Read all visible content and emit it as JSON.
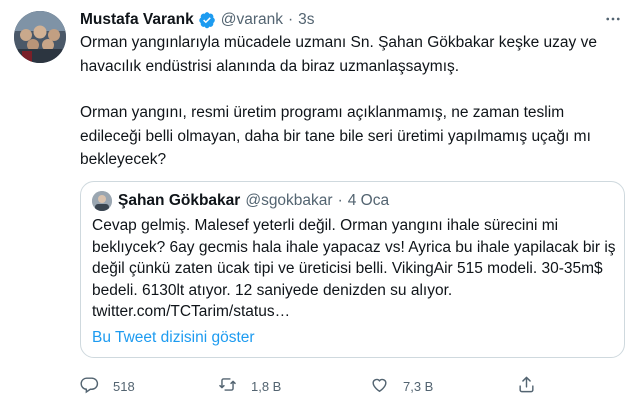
{
  "tweet": {
    "author_name": "Mustafa Varank",
    "handle": "@varank",
    "separator": "·",
    "time": "3s",
    "paragraphs": [
      "Orman yangınlarıyla mücadele uzmanı Sn. Şahan Gökbakar keşke uzay ve havacılık endüstrisi alanında da biraz uzmanlaşsaymış.",
      "Orman yangını, resmi üretim programı açıklanmamış, ne zaman teslim edileceği belli olmayan, daha bir tane bile seri üretimi yapılmamış uçağı mı bekleyecek?"
    ]
  },
  "quote": {
    "author_name": "Şahan Gökbakar",
    "handle": "@sgokbakar",
    "separator": "·",
    "time": "4 Oca",
    "text": "Cevap gelmiş. Malesef yeterli değil. Orman yangını ihale sürecini mi beklıycek? 6ay gecmis hala ihale yapacaz vs! Ayrica bu ihale yapilacak bir iş değil çünkü zaten ücak tipi ve üreticisi belli. VikingAir 515 modeli. 30-35m$ bedeli. 6130lt atıyor. 12 saniyede denizden su alıyor. twitter.com/TCTarim/status…",
    "show_thread": "Bu Tweet dizisini göster"
  },
  "actions": {
    "replies": "518",
    "retweets": "1,8 B",
    "likes": "7,3 B"
  },
  "icons": {
    "verified": "verified-badge-icon",
    "more": "more-horizontal-icon",
    "reply": "reply-icon",
    "retweet": "retweet-icon",
    "like": "heart-icon",
    "share": "share-icon"
  },
  "colors": {
    "accent": "#1d9bf0",
    "text": "#0f1419",
    "secondary": "#536471",
    "border": "#cfd9de"
  }
}
